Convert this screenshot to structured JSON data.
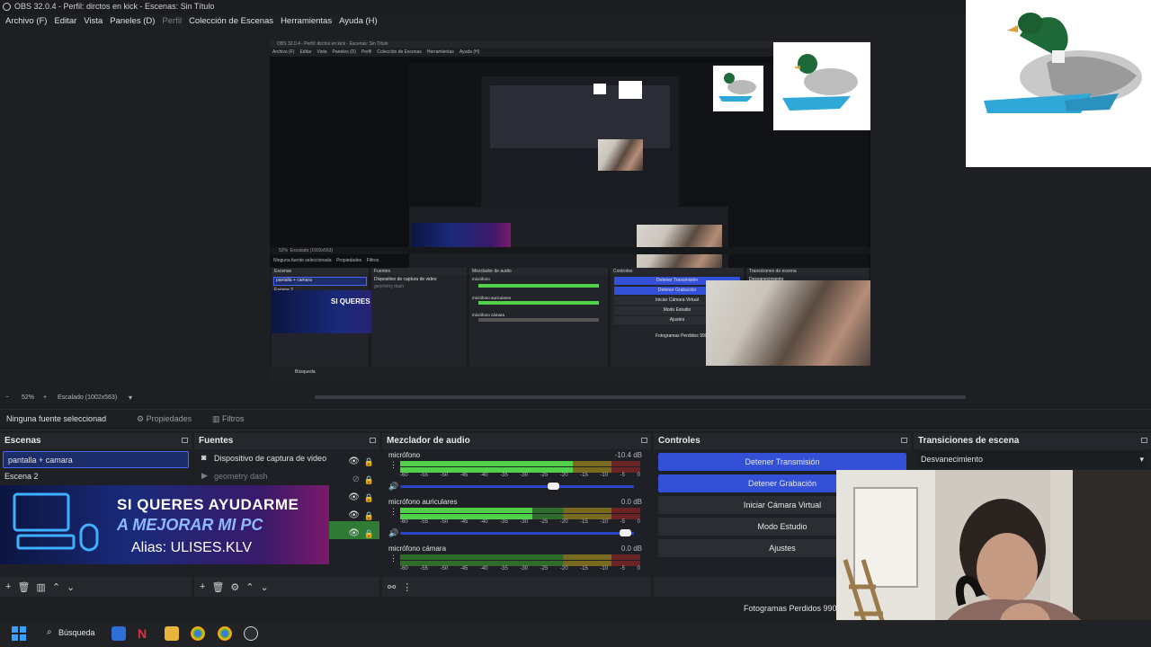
{
  "window": {
    "title": "OBS 32.0.4 - Perfil: dirctos en kick - Escenas: Sin Título"
  },
  "menu": [
    "Archivo (F)",
    "Editar",
    "Vista",
    "Paneles (D)",
    "Perfil",
    "Colección de Escenas",
    "Herramientas",
    "Ayuda (H)"
  ],
  "nested": {
    "title": "OBS 32.0.4 - Perfil: dirctos en kick - Escenas: Sin Título",
    "menu": [
      "Archivo (F)",
      "Editar",
      "Vista",
      "Paneles (D)",
      "Perfil",
      "Colección de Escenas",
      "Herramientas",
      "Ayuda (H)"
    ],
    "zoom": "52%",
    "scale": "Escalado (1002x563)",
    "no_source": "Ninguna fuente seleccionada",
    "props": "Propiedades",
    "filters": "Filtros",
    "headers": {
      "scenes": "Escenas",
      "sources": "Fuentes",
      "mixer": "Mezclador de audio",
      "controls": "Controles",
      "transitions": "Transiciones de escena"
    },
    "scenes": [
      "pantalla + camara",
      "Escena 2"
    ],
    "sources": [
      "Dispositivo de captura de video",
      "geometry dash"
    ],
    "mixer": [
      {
        "name": "micrófono",
        "db": "-10.4 dB"
      },
      {
        "name": "micrófono auriculares",
        "db": "0.0 dB"
      },
      {
        "name": "micrófono cámara",
        "db": "0.0 dB"
      }
    ],
    "controls": [
      "Detener Transmisión",
      "Detener Grabación",
      "Iniciar Cámara Virtual",
      "Modo Estudio",
      "Ajustes"
    ],
    "transition": "Desvanecimiento",
    "dropped": "Fotogramas Perdidos 990",
    "search": "Búsqueda"
  },
  "promo": {
    "line1": "SI QUERES AYUDARME",
    "line2": "A MEJORAR MI PC",
    "line3": "Alias: ULISES.KLV"
  },
  "statusbar": {
    "zoom": "52%",
    "scale": "Escalado (1002x563)"
  },
  "propsbar": {
    "no_source": "Ninguna fuente seleccionad",
    "properties": "Propiedades",
    "filters": "Filtros"
  },
  "docks": {
    "scenes": {
      "title": "Escenas",
      "items": [
        "pantalla + camara",
        "Escena 2"
      ]
    },
    "sources": {
      "title": "Fuentes",
      "items": [
        "Dispositivo de captura de video",
        "geometry dash"
      ]
    },
    "mixer": {
      "title": "Mezclador de audio",
      "ticks": [
        "-60",
        "-55",
        "-50",
        "-45",
        "-40",
        "-35",
        "-30",
        "-25",
        "-20",
        "-15",
        "-10",
        "-5",
        "0"
      ],
      "channels": [
        {
          "name": "micrófono",
          "db": "-10.4 dB",
          "level": 0.72,
          "volume": 0.66
        },
        {
          "name": "micrófono auriculares",
          "db": "0.0 dB",
          "level": 0.55,
          "volume": 0.97
        },
        {
          "name": "micrófono cámara",
          "db": "0.0 dB",
          "level": 0.0,
          "volume": 0.0
        }
      ]
    },
    "controls": {
      "title": "Controles",
      "buttons": [
        "Detener Transmisión",
        "Detener Grabación",
        "Iniciar Cámara Virtual",
        "Modo Estudio",
        "Ajustes"
      ]
    },
    "transitions": {
      "title": "Transiciones de escena",
      "selected": "Desvanecimiento"
    }
  },
  "footer": {
    "dropped": "Fotogramas Perdidos 990"
  },
  "taskbar": {
    "search": "Búsqueda"
  },
  "colors": {
    "accent": "#3350d6",
    "bg": "#1d1f23",
    "panel": "#25272c"
  }
}
